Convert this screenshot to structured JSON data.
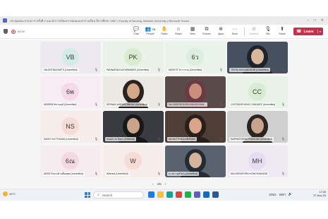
{
  "window": {
    "title": "ประชุมคณะกรรมการ ครั้งที่ 2 แนะนำการเรียนการสอนและตารางเรียน ปีการศึกษา 2567 | Faculty of Nursing, Mahidol University | Microsoft Teams",
    "controls": [
      "–",
      "□",
      "✕"
    ]
  },
  "toolbar": {
    "timer": "00:50",
    "tools": [
      {
        "label": "Chat",
        "icon": "chat-icon",
        "glyph": "💬"
      },
      {
        "label": "People",
        "icon": "people-icon",
        "glyph": "👥",
        "count": "70"
      },
      {
        "label": "Raise",
        "icon": "raise-hand-icon",
        "glyph": "✋"
      },
      {
        "label": "React",
        "icon": "react-icon",
        "glyph": "☺"
      },
      {
        "label": "View",
        "icon": "view-icon",
        "glyph": "▦"
      },
      {
        "label": "Rooms",
        "icon": "rooms-icon",
        "glyph": "⧉"
      },
      {
        "label": "Apps",
        "icon": "apps-icon",
        "glyph": "⊕"
      },
      {
        "label": "More",
        "icon": "more-icon",
        "glyph": "···"
      }
    ],
    "media": [
      {
        "label": "Camera",
        "icon": "camera-off-icon",
        "glyph": "⊘"
      },
      {
        "label": "Mic",
        "icon": "mic-icon",
        "glyph": "🎙"
      },
      {
        "label": "Share",
        "icon": "share-icon",
        "glyph": "⬆"
      }
    ],
    "leave_label": "Leave",
    "leave_dropdown": "▾"
  },
  "participants": [
    {
      "initials": "VB",
      "name": "VALENTINA BAPTI (Unverified)",
      "avatar_bg": "#d3ece6",
      "tile_bg": "#ece9f0",
      "video": false
    },
    {
      "initials": "PK",
      "name": "PANNARAN KAOWMANEE (Unverified)",
      "avatar_bg": "#d9ecd0",
      "tile_bg": "#eaf1e6",
      "video": false
    },
    {
      "initials": "6ว",
      "name": "6609175 วิภาวรรณ (Unverified)",
      "avatar_bg": "#dceedd",
      "tile_bg": "#eaf3ea",
      "video": false
    },
    {
      "initials": "",
      "name": "TEERA MUKANDOHIN (Unverified)",
      "avatar_bg": "",
      "tile_bg": "#2c3340",
      "video": true,
      "video_palette": [
        "#46505f",
        "#d9b79a",
        "#1d232b"
      ]
    },
    {
      "initials": "6พ",
      "name": "6609095 พิชามญช์ (Unverified)",
      "avatar_bg": "#f5d9ea",
      "tile_bg": "#f7ecf3",
      "video": false
    },
    {
      "initials": "",
      "name": "SIRINAN KAEWKOMKAM (Unverified)",
      "avatar_bg": "",
      "tile_bg": "#e8e4de",
      "video": true,
      "video_palette": [
        "#ece9e4",
        "#d2a888",
        "#2a2220"
      ]
    },
    {
      "initials": "",
      "name": "Ms.SASIPASSORN BUNGSOMA...",
      "avatar_bg": "",
      "tile_bg": "#3a2f32",
      "video": true,
      "video_palette": [
        "#5a4a4a",
        "#c98e7c",
        "#6a3a42"
      ]
    },
    {
      "initials": "CC",
      "name": "CHITSANPHONG CHANDEE (Unverified)",
      "avatar_bg": "#d8ecd4",
      "tile_bg": "#e9f2e6",
      "video": false
    },
    {
      "initials": "NS",
      "name": "NATAT SUTTHISAN (Unverified)",
      "avatar_bg": "#f7dcd6",
      "tile_bg": "#f6ece9",
      "video": false
    },
    {
      "initials": "",
      "name": "ขนมหวาน ปิยดา (External)",
      "avatar_bg": "",
      "tile_bg": "#2a2a2e",
      "video": true,
      "video_palette": [
        "#3a3b40",
        "#c9a38a",
        "#181818"
      ]
    },
    {
      "initials": "",
      "name": "Ms.NUTTHIMA MEEMAK",
      "avatar_bg": "",
      "tile_bg": "#3b2f2a",
      "video": true,
      "video_palette": [
        "#4e3e36",
        "#d8a48a",
        "#2a1e1a"
      ]
    },
    {
      "initials": "",
      "name": "NAPHATSORN PHAKKAM (Unverified)",
      "avatar_bg": "",
      "tile_bg": "#d7d7d7",
      "video": true,
      "video_palette": [
        "#cfcfcf",
        "#caa38c",
        "#2b2521"
      ]
    },
    {
      "initials": "6ณ",
      "name": "6609170ณรงค์ เหลืองพุฒ (Unverified)",
      "avatar_bg": "#f5d9e2",
      "tile_bg": "#f6ecef",
      "video": false
    },
    {
      "initials": "W",
      "name": "Witchud (Unverified)",
      "avatar_bg": "#f5dcd7",
      "tile_bg": "#f6ecea",
      "video": false
    },
    {
      "initials": "",
      "name": "นางสาวภูมิรัตน์ (Unverified)",
      "avatar_bg": "",
      "tile_bg": "#4a4e57",
      "video": true,
      "video_palette": [
        "#5a6270",
        "#d4b49c",
        "#262b33"
      ]
    },
    {
      "initials": "MH",
      "name": "Ms.KIDRAPORN HOMCHAWONG",
      "avatar_bg": "#e7dcf2",
      "tile_bg": "#eee9f3",
      "video": false
    }
  ],
  "pager": {
    "prev": "‹",
    "text": "4/5",
    "next": "›"
  },
  "taskbar": {
    "weather": "28°C",
    "search_placeholder": "Search",
    "apps": [
      {
        "icon": "widgets-icon",
        "color": "#1f7ae0"
      },
      {
        "icon": "file-explorer-icon",
        "color": "#f3c236"
      },
      {
        "icon": "edge-icon",
        "color": "#1aa38c"
      },
      {
        "icon": "chrome-icon",
        "color": "#e0453a"
      },
      {
        "icon": "line-icon",
        "color": "#22b14c"
      },
      {
        "icon": "teams-icon",
        "color": "#5b5fc7"
      },
      {
        "icon": "store-icon",
        "color": "#0f6cbd"
      },
      {
        "icon": "word-icon",
        "color": "#2b579a"
      }
    ],
    "tray": [
      "ENG",
      "WiFi",
      "🔊"
    ],
    "time": "17:30",
    "date": "27-Nov-24"
  }
}
